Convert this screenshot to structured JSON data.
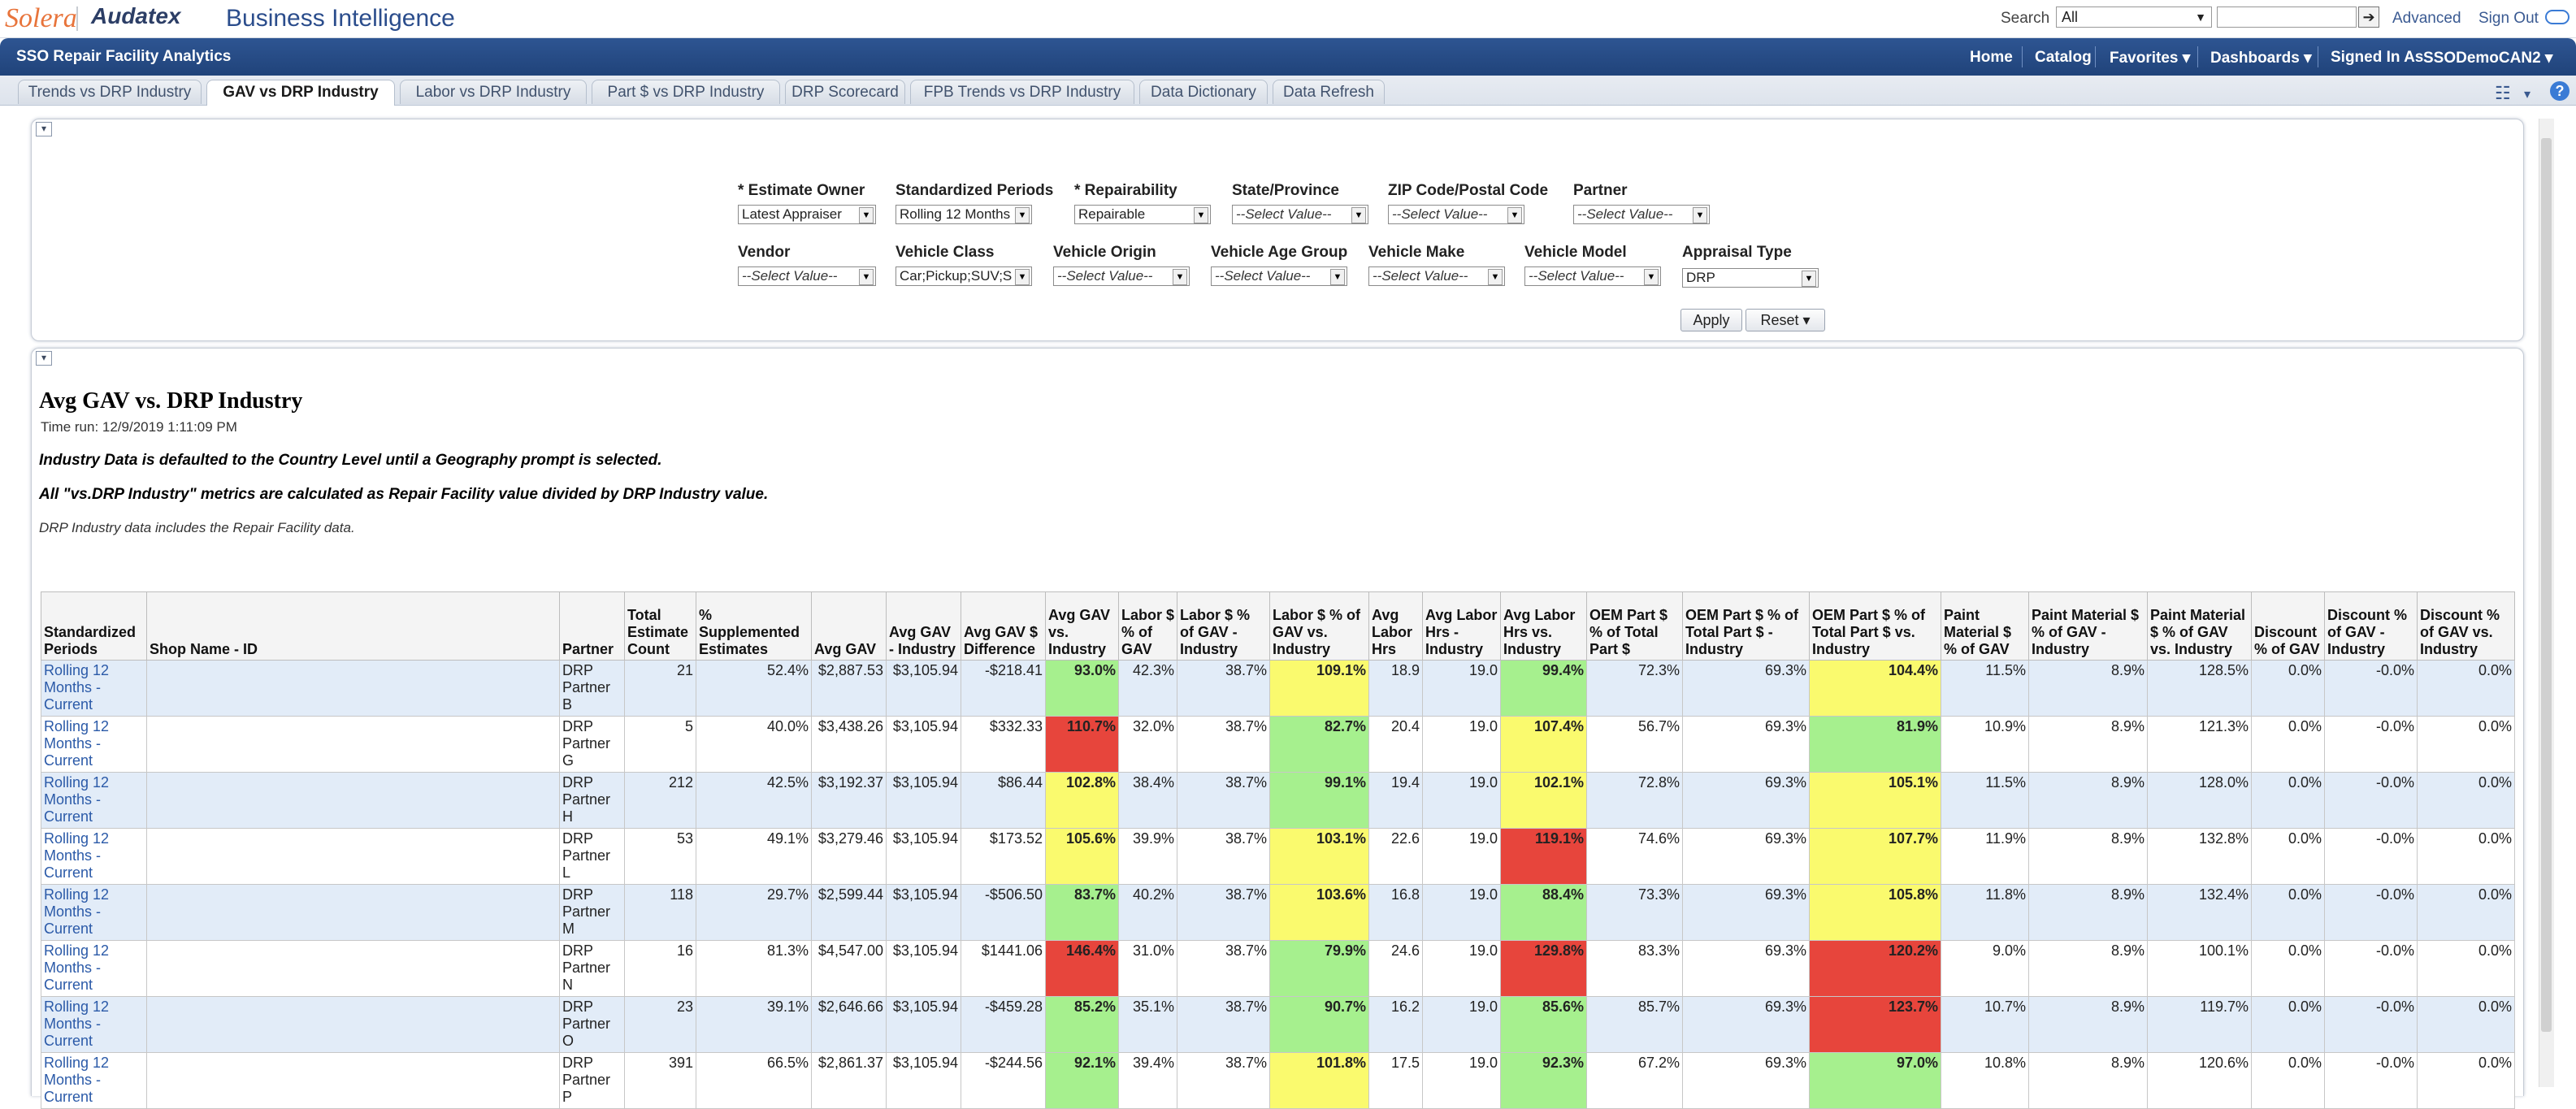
{
  "header": {
    "logo": "Solera",
    "brand": "Audatex",
    "product": "Business Intelligence",
    "search_label": "Search",
    "search_scope": "All",
    "search_placeholder": "",
    "advanced": "Advanced",
    "sign_out": "Sign Out"
  },
  "nav": {
    "title": "SSO Repair Facility Analytics",
    "home": "Home",
    "catalog": "Catalog",
    "favorites": "Favorites ▾",
    "dashboards": "Dashboards ▾",
    "signed_in_label": "Signed In As",
    "user": "SSODemoCAN2 ▾"
  },
  "tabs": [
    "Trends vs DRP Industry",
    "GAV vs DRP Industry",
    "Labor vs DRP Industry",
    "Part $ vs DRP Industry",
    "DRP Scorecard",
    "FPB Trends vs DRP Industry",
    "Data Dictionary",
    "Data Refresh"
  ],
  "prompts": {
    "estimate_owner": {
      "label": "* Estimate Owner",
      "value": "Latest Appraiser"
    },
    "standardized_periods": {
      "label": "Standardized Periods",
      "value": "Rolling 12 Months"
    },
    "repairability": {
      "label": "* Repairability",
      "value": "Repairable"
    },
    "state_province": {
      "label": "State/Province",
      "value": "--Select Value--"
    },
    "zip_code": {
      "label": "ZIP Code/Postal Code",
      "value": "--Select Value--"
    },
    "partner": {
      "label": "Partner",
      "value": "--Select Value--"
    },
    "vendor": {
      "label": "Vendor",
      "value": "--Select Value--"
    },
    "vehicle_class": {
      "label": "Vehicle Class",
      "value": "Car;Pickup;SUV;S"
    },
    "vehicle_origin": {
      "label": "Vehicle Origin",
      "value": "--Select Value--"
    },
    "vehicle_age_group": {
      "label": "Vehicle Age Group",
      "value": "--Select Value--"
    },
    "vehicle_make": {
      "label": "Vehicle Make",
      "value": "--Select Value--"
    },
    "vehicle_model": {
      "label": "Vehicle Model",
      "value": "--Select Value--"
    },
    "appraisal_type": {
      "label": "Appraisal Type",
      "value": "DRP"
    },
    "apply": "Apply",
    "reset": "Reset ▾"
  },
  "report": {
    "title": "Avg GAV vs. DRP Industry",
    "time_run": "Time run: 12/9/2019 1:11:09 PM",
    "note1": "Industry Data is defaulted to the Country Level until a Geography prompt is selected.",
    "note2": "All \"vs.DRP Industry\" metrics are calculated as Repair Facility value divided by DRP Industry value.",
    "note3": "DRP Industry data includes the Repair Facility data."
  },
  "table": {
    "columns": [
      "Standardized Periods",
      "Shop Name - ID",
      "Partner",
      "Total Estimate Count",
      "% Supplemented Estimates",
      "Avg GAV",
      "Avg GAV - Industry",
      "Avg GAV $ Difference",
      "Avg GAV vs. Industry",
      "Labor $ % of GAV",
      "Labor $ % of GAV - Industry",
      "Labor $ % of GAV vs. Industry",
      "Avg Labor Hrs",
      "Avg Labor Hrs - Industry",
      "Avg Labor Hrs vs. Industry",
      "OEM Part $ % of Total Part $",
      "OEM Part $ % of Total Part $ - Industry",
      "OEM Part $ % of Total Part $ vs. Industry",
      "Paint Material $ % of GAV",
      "Paint Material $ % of GAV - Industry",
      "Paint Material $ % of GAV vs. Industry",
      "Discount % of GAV",
      "Discount % of GAV - Industry",
      "Discount % of GAV vs. Industry"
    ],
    "rows": [
      {
        "period": "Rolling 12 Months - Current",
        "shop": "",
        "partner": "DRP Partner B",
        "count": "21",
        "supp": "52.4%",
        "gav": "$2,887.53",
        "gav_ind": "$3,105.94",
        "gav_diff": "-$218.41",
        "gav_vs": "93.0%",
        "gav_vs_c": "g",
        "lab": "42.3%",
        "lab_ind": "38.7%",
        "lab_vs": "109.1%",
        "lab_vs_c": "y",
        "hrs": "18.9",
        "hrs_ind": "19.0",
        "hrs_vs": "99.4%",
        "hrs_vs_c": "g",
        "oem": "72.3%",
        "oem_ind": "69.3%",
        "oem_vs": "104.4%",
        "oem_vs_c": "y",
        "pm": "11.5%",
        "pm_ind": "8.9%",
        "pm_vs": "128.5%",
        "disc": "0.0%",
        "disc_ind": "-0.0%",
        "disc_vs": "0.0%"
      },
      {
        "period": "Rolling 12 Months - Current",
        "shop": "",
        "partner": "DRP Partner G",
        "count": "5",
        "supp": "40.0%",
        "gav": "$3,438.26",
        "gav_ind": "$3,105.94",
        "gav_diff": "$332.33",
        "gav_vs": "110.7%",
        "gav_vs_c": "r",
        "lab": "32.0%",
        "lab_ind": "38.7%",
        "lab_vs": "82.7%",
        "lab_vs_c": "g",
        "hrs": "20.4",
        "hrs_ind": "19.0",
        "hrs_vs": "107.4%",
        "hrs_vs_c": "y",
        "oem": "56.7%",
        "oem_ind": "69.3%",
        "oem_vs": "81.9%",
        "oem_vs_c": "g",
        "pm": "10.9%",
        "pm_ind": "8.9%",
        "pm_vs": "121.3%",
        "disc": "0.0%",
        "disc_ind": "-0.0%",
        "disc_vs": "0.0%"
      },
      {
        "period": "Rolling 12 Months - Current",
        "shop": "",
        "partner": "DRP Partner H",
        "count": "212",
        "supp": "42.5%",
        "gav": "$3,192.37",
        "gav_ind": "$3,105.94",
        "gav_diff": "$86.44",
        "gav_vs": "102.8%",
        "gav_vs_c": "y",
        "lab": "38.4%",
        "lab_ind": "38.7%",
        "lab_vs": "99.1%",
        "lab_vs_c": "g",
        "hrs": "19.4",
        "hrs_ind": "19.0",
        "hrs_vs": "102.1%",
        "hrs_vs_c": "y",
        "oem": "72.8%",
        "oem_ind": "69.3%",
        "oem_vs": "105.1%",
        "oem_vs_c": "y",
        "pm": "11.5%",
        "pm_ind": "8.9%",
        "pm_vs": "128.0%",
        "disc": "0.0%",
        "disc_ind": "-0.0%",
        "disc_vs": "0.0%"
      },
      {
        "period": "Rolling 12 Months - Current",
        "shop": "",
        "partner": "DRP Partner L",
        "count": "53",
        "supp": "49.1%",
        "gav": "$3,279.46",
        "gav_ind": "$3,105.94",
        "gav_diff": "$173.52",
        "gav_vs": "105.6%",
        "gav_vs_c": "y",
        "lab": "39.9%",
        "lab_ind": "38.7%",
        "lab_vs": "103.1%",
        "lab_vs_c": "y",
        "hrs": "22.6",
        "hrs_ind": "19.0",
        "hrs_vs": "119.1%",
        "hrs_vs_c": "r",
        "oem": "74.6%",
        "oem_ind": "69.3%",
        "oem_vs": "107.7%",
        "oem_vs_c": "y",
        "pm": "11.9%",
        "pm_ind": "8.9%",
        "pm_vs": "132.8%",
        "disc": "0.0%",
        "disc_ind": "-0.0%",
        "disc_vs": "0.0%"
      },
      {
        "period": "Rolling 12 Months - Current",
        "shop": "",
        "partner": "DRP Partner M",
        "count": "118",
        "supp": "29.7%",
        "gav": "$2,599.44",
        "gav_ind": "$3,105.94",
        "gav_diff": "-$506.50",
        "gav_vs": "83.7%",
        "gav_vs_c": "g",
        "lab": "40.2%",
        "lab_ind": "38.7%",
        "lab_vs": "103.6%",
        "lab_vs_c": "y",
        "hrs": "16.8",
        "hrs_ind": "19.0",
        "hrs_vs": "88.4%",
        "hrs_vs_c": "g",
        "oem": "73.3%",
        "oem_ind": "69.3%",
        "oem_vs": "105.8%",
        "oem_vs_c": "y",
        "pm": "11.8%",
        "pm_ind": "8.9%",
        "pm_vs": "132.4%",
        "disc": "0.0%",
        "disc_ind": "-0.0%",
        "disc_vs": "0.0%"
      },
      {
        "period": "Rolling 12 Months - Current",
        "shop": "",
        "partner": "DRP Partner N",
        "count": "16",
        "supp": "81.3%",
        "gav": "$4,547.00",
        "gav_ind": "$3,105.94",
        "gav_diff": "$1441.06",
        "gav_vs": "146.4%",
        "gav_vs_c": "r",
        "lab": "31.0%",
        "lab_ind": "38.7%",
        "lab_vs": "79.9%",
        "lab_vs_c": "g",
        "hrs": "24.6",
        "hrs_ind": "19.0",
        "hrs_vs": "129.8%",
        "hrs_vs_c": "r",
        "oem": "83.3%",
        "oem_ind": "69.3%",
        "oem_vs": "120.2%",
        "oem_vs_c": "r",
        "pm": "9.0%",
        "pm_ind": "8.9%",
        "pm_vs": "100.1%",
        "disc": "0.0%",
        "disc_ind": "-0.0%",
        "disc_vs": "0.0%"
      },
      {
        "period": "Rolling 12 Months - Current",
        "shop": "",
        "partner": "DRP Partner O",
        "count": "23",
        "supp": "39.1%",
        "gav": "$2,646.66",
        "gav_ind": "$3,105.94",
        "gav_diff": "-$459.28",
        "gav_vs": "85.2%",
        "gav_vs_c": "g",
        "lab": "35.1%",
        "lab_ind": "38.7%",
        "lab_vs": "90.7%",
        "lab_vs_c": "g",
        "hrs": "16.2",
        "hrs_ind": "19.0",
        "hrs_vs": "85.6%",
        "hrs_vs_c": "g",
        "oem": "85.7%",
        "oem_ind": "69.3%",
        "oem_vs": "123.7%",
        "oem_vs_c": "r",
        "pm": "10.7%",
        "pm_ind": "8.9%",
        "pm_vs": "119.7%",
        "disc": "0.0%",
        "disc_ind": "-0.0%",
        "disc_vs": "0.0%"
      },
      {
        "period": "Rolling 12 Months - Current",
        "shop": "",
        "partner": "DRP Partner P",
        "count": "391",
        "supp": "66.5%",
        "gav": "$2,861.37",
        "gav_ind": "$3,105.94",
        "gav_diff": "-$244.56",
        "gav_vs": "92.1%",
        "gav_vs_c": "g",
        "lab": "39.4%",
        "lab_ind": "38.7%",
        "lab_vs": "101.8%",
        "lab_vs_c": "y",
        "hrs": "17.5",
        "hrs_ind": "19.0",
        "hrs_vs": "92.3%",
        "hrs_vs_c": "g",
        "oem": "67.2%",
        "oem_ind": "69.3%",
        "oem_vs": "97.0%",
        "oem_vs_c": "g",
        "pm": "10.8%",
        "pm_ind": "8.9%",
        "pm_vs": "120.6%",
        "disc": "0.0%",
        "disc_ind": "-0.0%",
        "disc_vs": "0.0%"
      }
    ]
  },
  "colors": {
    "nav_bg": "#2e5592",
    "good": "#a6f08e",
    "warn": "#fafa6e",
    "bad": "#e7453c",
    "row_alt": "#e2ecf8"
  }
}
